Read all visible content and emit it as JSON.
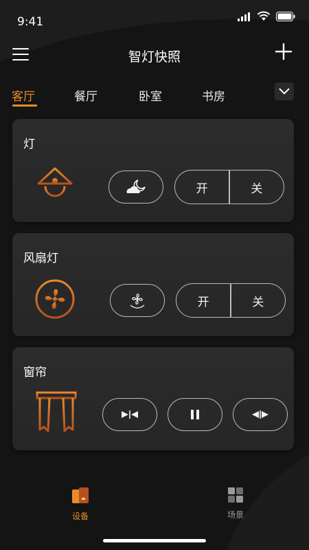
{
  "status_bar": {
    "time": "9:41"
  },
  "header": {
    "title": "智灯快照"
  },
  "tabs": [
    {
      "label": "客厅",
      "active": true
    },
    {
      "label": "餐厅",
      "active": false
    },
    {
      "label": "卧室",
      "active": false
    },
    {
      "label": "书房",
      "active": false
    }
  ],
  "cards": {
    "light": {
      "title": "灯",
      "on_label": "开",
      "off_label": "关"
    },
    "fan_light": {
      "title": "风扇灯",
      "on_label": "开",
      "off_label": "关"
    },
    "curtain": {
      "title": "窗帘"
    }
  },
  "bottom_nav": {
    "devices": {
      "label": "设备",
      "active": true
    },
    "scenes": {
      "label": "场景",
      "active": false
    }
  },
  "colors": {
    "accent": "#e98b2a",
    "accent_dark": "#b8501d",
    "background": "#141414",
    "card": "#2a2a2a",
    "outline": "#bdbdbd"
  }
}
